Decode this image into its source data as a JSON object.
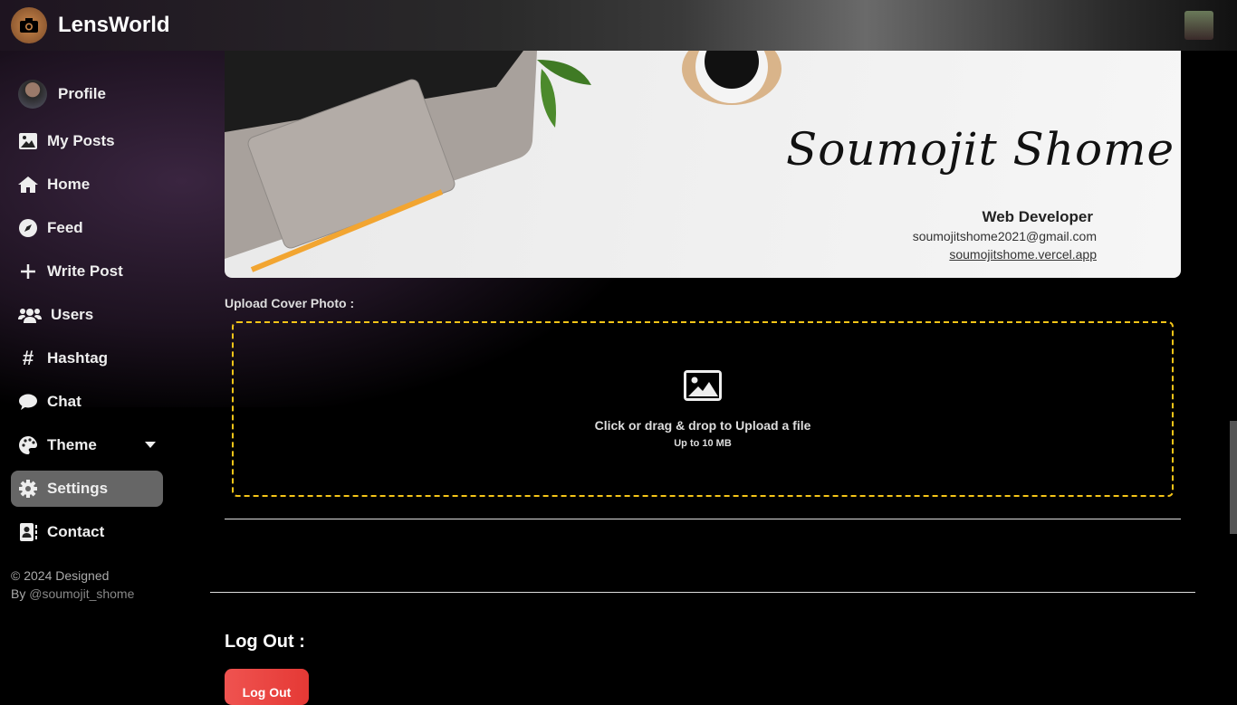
{
  "header": {
    "brand": "LensWorld"
  },
  "sidebar": {
    "items": [
      {
        "label": "Profile",
        "icon": "avatar"
      },
      {
        "label": "My Posts",
        "icon": "image-icon"
      },
      {
        "label": "Home",
        "icon": "home-icon"
      },
      {
        "label": "Feed",
        "icon": "compass-icon"
      },
      {
        "label": "Write Post",
        "icon": "plus-icon"
      },
      {
        "label": "Users",
        "icon": "users-icon"
      },
      {
        "label": "Hashtag",
        "icon": "hashtag-icon"
      },
      {
        "label": "Chat",
        "icon": "chat-icon"
      },
      {
        "label": "Theme",
        "icon": "palette-icon"
      },
      {
        "label": "Settings",
        "icon": "gear-icon",
        "active": true
      },
      {
        "label": "Contact",
        "icon": "contact-icon"
      }
    ],
    "footer_line1": "© 2024 Designed",
    "footer_by": "By",
    "footer_handle": "@soumojit_shome"
  },
  "cover": {
    "signature": "Soumojit Shome",
    "role": "Web Developer",
    "email": "soumojitshome2021@gmail.com",
    "website": "soumojitshome.vercel.app"
  },
  "upload": {
    "label": "Upload Cover Photo :",
    "prompt": "Click or drag & drop to Upload a file",
    "limit": "Up to 10 MB"
  },
  "logout": {
    "title": "Log Out :",
    "button": "Log Out"
  },
  "colors": {
    "dropzone_border": "#f5c518",
    "logout_button": "#e53935",
    "active_nav": "#666666"
  }
}
